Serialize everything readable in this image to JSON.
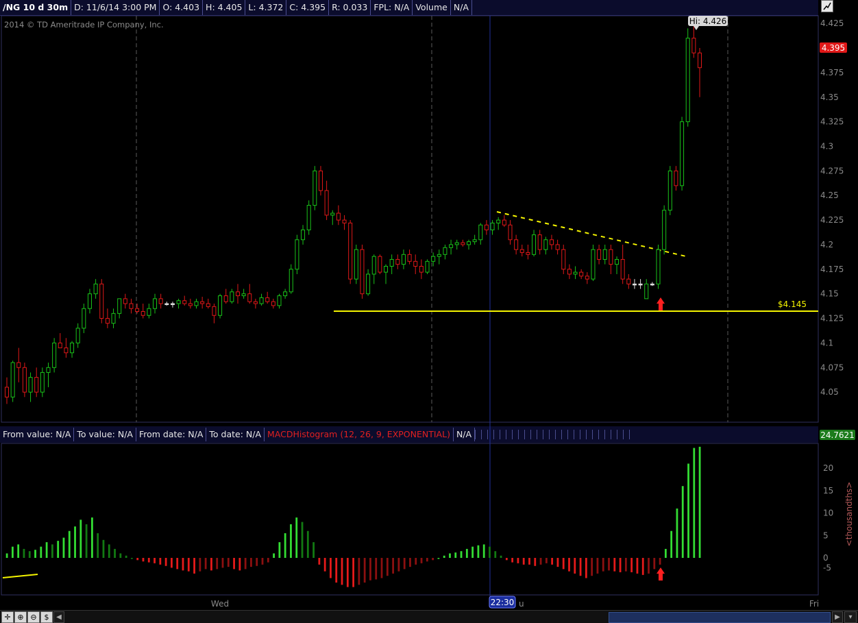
{
  "header": {
    "symbol": "/NG 10 d 30m",
    "date": "D: 11/6/14 3:00 PM",
    "open": "O: 4.403",
    "high": "H: 4.405",
    "low": "L: 4.372",
    "close": "C: 4.395",
    "range": "R: 0.033",
    "fpl": "FPL: N/A",
    "volume_label": "Volume",
    "volume_value": "N/A"
  },
  "copyright": "2014 © TD Ameritrade IP Company, Inc.",
  "hi_label": "Hi: 4.426",
  "last_price_label": "4.395",
  "level_label": "$4.145",
  "lower_header": {
    "from_value": "From value: N/A",
    "to_value": "To value: N/A",
    "from_date": "From date: N/A",
    "to_date": "To date: N/A",
    "study": "MACDHistogram (12, 26, 9, EXPONENTIAL)",
    "study_value": "N/A",
    "last_value": "24.7621"
  },
  "time_axis": {
    "wed": "Wed",
    "cursor": "22:30",
    "thu_fragment": "u",
    "fri": "Fri"
  },
  "colors": {
    "up": "#19c319",
    "down": "#e01818",
    "hist_strong_up": "#33dd33",
    "hist_weak_up": "#127a12",
    "hist_strong_down": "#e51a1a",
    "hist_weak_down": "#8c1010",
    "support_line": "#f5f500",
    "trendline": "#f5f500",
    "arrow": "#ff2020",
    "price_badge": "#e01818",
    "macd_badge": "#1c7c1c"
  },
  "chart_data": [
    {
      "type": "candlestick",
      "title": "/NG 10 d 30m",
      "ylim": [
        4.025,
        4.43
      ],
      "yticks": [
        "4.425",
        "4.4",
        "4.375",
        "4.35",
        "4.325",
        "4.3",
        "4.275",
        "4.25",
        "4.225",
        "4.2",
        "4.175",
        "4.15",
        "4.125",
        "4.1",
        "4.075",
        "4.05"
      ],
      "annotations": {
        "high": 4.426,
        "last": 4.395,
        "support_level": 4.145,
        "support_label": "$4.145"
      },
      "candles": [
        [
          4.055,
          4.065,
          4.038,
          4.045
        ],
        [
          4.045,
          4.082,
          4.04,
          4.08
        ],
        [
          4.08,
          4.095,
          4.06,
          4.075
        ],
        [
          4.075,
          4.08,
          4.045,
          4.05
        ],
        [
          4.05,
          4.07,
          4.04,
          4.065
        ],
        [
          4.065,
          4.075,
          4.045,
          4.05
        ],
        [
          4.05,
          4.075,
          4.045,
          4.07
        ],
        [
          4.07,
          4.08,
          4.055,
          4.075
        ],
        [
          4.075,
          4.105,
          4.07,
          4.1
        ],
        [
          4.1,
          4.11,
          4.095,
          4.095
        ],
        [
          4.095,
          4.105,
          4.085,
          4.09
        ],
        [
          4.09,
          4.102,
          4.085,
          4.1
        ],
        [
          4.1,
          4.12,
          4.095,
          4.115
        ],
        [
          4.115,
          4.14,
          4.11,
          4.135
        ],
        [
          4.135,
          4.155,
          4.13,
          4.15
        ],
        [
          4.15,
          4.165,
          4.145,
          4.16
        ],
        [
          4.16,
          4.165,
          4.12,
          4.125
        ],
        [
          4.125,
          4.135,
          4.115,
          4.12
        ],
        [
          4.12,
          4.135,
          4.115,
          4.13
        ],
        [
          4.13,
          4.145,
          4.125,
          4.145
        ],
        [
          4.145,
          4.15,
          4.135,
          4.14
        ],
        [
          4.14,
          4.145,
          4.13,
          4.135
        ],
        [
          4.135,
          4.14,
          4.13,
          4.132
        ],
        [
          4.132,
          4.14,
          4.125,
          4.128
        ],
        [
          4.128,
          4.14,
          4.125,
          4.135
        ],
        [
          4.135,
          4.15,
          4.13,
          4.145
        ],
        [
          4.145,
          4.15,
          4.135,
          4.14
        ],
        [
          4.14,
          4.142,
          4.138,
          4.14
        ],
        [
          4.14,
          4.142,
          4.136,
          4.14
        ],
        [
          4.14,
          4.145,
          4.135,
          4.143
        ],
        [
          4.143,
          4.148,
          4.138,
          4.14
        ],
        [
          4.14,
          4.145,
          4.135,
          4.138
        ],
        [
          4.138,
          4.145,
          4.135,
          4.142
        ],
        [
          4.142,
          4.147,
          4.135,
          4.14
        ],
        [
          4.14,
          4.145,
          4.135,
          4.137
        ],
        [
          4.137,
          4.14,
          4.12,
          4.128
        ],
        [
          4.128,
          4.15,
          4.125,
          4.148
        ],
        [
          4.148,
          4.155,
          4.14,
          4.142
        ],
        [
          4.142,
          4.155,
          4.14,
          4.152
        ],
        [
          4.152,
          4.16,
          4.14,
          4.148
        ],
        [
          4.148,
          4.155,
          4.145,
          4.15
        ],
        [
          4.15,
          4.16,
          4.14,
          4.142
        ],
        [
          4.142,
          4.145,
          4.135,
          4.14
        ],
        [
          4.14,
          4.15,
          4.138,
          4.146
        ],
        [
          4.146,
          4.152,
          4.14,
          4.142
        ],
        [
          4.142,
          4.145,
          4.135,
          4.138
        ],
        [
          4.138,
          4.15,
          4.135,
          4.148
        ],
        [
          4.148,
          4.155,
          4.145,
          4.152
        ],
        [
          4.152,
          4.18,
          4.15,
          4.175
        ],
        [
          4.175,
          4.21,
          4.17,
          4.205
        ],
        [
          4.205,
          4.22,
          4.2,
          4.215
        ],
        [
          4.215,
          4.245,
          4.21,
          4.24
        ],
        [
          4.24,
          4.28,
          4.235,
          4.275
        ],
        [
          4.275,
          4.28,
          4.25,
          4.255
        ],
        [
          4.255,
          4.265,
          4.225,
          4.23
        ],
        [
          4.23,
          4.235,
          4.22,
          4.232
        ],
        [
          4.232,
          4.24,
          4.22,
          4.225
        ],
        [
          4.225,
          4.23,
          4.215,
          4.222
        ],
        [
          4.222,
          4.225,
          4.16,
          4.165
        ],
        [
          4.165,
          4.2,
          4.16,
          4.195
        ],
        [
          4.195,
          4.2,
          4.145,
          4.15
        ],
        [
          4.15,
          4.175,
          4.148,
          4.17
        ],
        [
          4.17,
          4.19,
          4.16,
          4.188
        ],
        [
          4.188,
          4.19,
          4.17,
          4.172
        ],
        [
          4.172,
          4.18,
          4.16,
          4.178
        ],
        [
          4.178,
          4.19,
          4.17,
          4.185
        ],
        [
          4.185,
          4.19,
          4.175,
          4.18
        ],
        [
          4.18,
          4.195,
          4.175,
          4.19
        ],
        [
          4.19,
          4.195,
          4.18,
          4.183
        ],
        [
          4.183,
          4.19,
          4.17,
          4.178
        ],
        [
          4.178,
          4.185,
          4.165,
          4.172
        ],
        [
          4.172,
          4.185,
          4.17,
          4.183
        ],
        [
          4.183,
          4.192,
          4.178,
          4.188
        ],
        [
          4.188,
          4.195,
          4.18,
          4.19
        ],
        [
          4.19,
          4.2,
          4.185,
          4.197
        ],
        [
          4.197,
          4.205,
          4.19,
          4.2
        ],
        [
          4.2,
          4.205,
          4.195,
          4.202
        ],
        [
          4.202,
          4.205,
          4.198,
          4.2
        ],
        [
          4.2,
          4.205,
          4.195,
          4.203
        ],
        [
          4.203,
          4.21,
          4.2,
          4.205
        ],
        [
          4.205,
          4.222,
          4.2,
          4.22
        ],
        [
          4.22,
          4.225,
          4.21,
          4.215
        ],
        [
          4.215,
          4.225,
          4.21,
          4.222
        ],
        [
          4.222,
          4.228,
          4.215,
          4.225
        ],
        [
          4.225,
          4.23,
          4.218,
          4.22
        ],
        [
          4.22,
          4.225,
          4.2,
          4.205
        ],
        [
          4.205,
          4.21,
          4.19,
          4.195
        ],
        [
          4.195,
          4.2,
          4.188,
          4.192
        ],
        [
          4.192,
          4.2,
          4.185,
          4.19
        ],
        [
          4.19,
          4.215,
          4.188,
          4.21
        ],
        [
          4.21,
          4.215,
          4.19,
          4.195
        ],
        [
          4.195,
          4.208,
          4.19,
          4.205
        ],
        [
          4.205,
          4.21,
          4.195,
          4.2
        ],
        [
          4.2,
          4.205,
          4.19,
          4.195
        ],
        [
          4.195,
          4.2,
          4.17,
          4.175
        ],
        [
          4.175,
          4.18,
          4.165,
          4.17
        ],
        [
          4.17,
          4.178,
          4.165,
          4.172
        ],
        [
          4.172,
          4.175,
          4.165,
          4.168
        ],
        [
          4.168,
          4.172,
          4.16,
          4.165
        ],
        [
          4.165,
          4.2,
          4.163,
          4.195
        ],
        [
          4.195,
          4.2,
          4.18,
          4.185
        ],
        [
          4.185,
          4.2,
          4.18,
          4.195
        ],
        [
          4.195,
          4.2,
          4.17,
          4.18
        ],
        [
          4.18,
          4.188,
          4.17,
          4.185
        ],
        [
          4.185,
          4.2,
          4.16,
          4.165
        ],
        [
          4.165,
          4.17,
          4.155,
          4.16
        ],
        [
          4.16,
          4.165,
          4.155,
          4.16
        ],
        [
          4.16,
          4.165,
          4.155,
          4.16
        ],
        [
          4.145,
          4.165,
          4.145,
          4.16
        ],
        [
          4.16,
          4.162,
          4.158,
          4.16
        ],
        [
          4.16,
          4.2,
          4.155,
          4.195
        ],
        [
          4.195,
          4.24,
          4.19,
          4.235
        ],
        [
          4.235,
          4.28,
          4.23,
          4.275
        ],
        [
          4.275,
          4.28,
          4.255,
          4.26
        ],
        [
          4.26,
          4.33,
          4.255,
          4.325
        ],
        [
          4.325,
          4.42,
          4.32,
          4.41
        ],
        [
          4.41,
          4.426,
          4.39,
          4.395
        ],
        [
          4.395,
          4.4,
          4.35,
          4.38
        ]
      ]
    },
    {
      "type": "bar",
      "title": "MACDHistogram (12, 26, 9, EXPONENTIAL)",
      "ylabel": "<thousandths>",
      "ylim": [
        -10,
        25
      ],
      "yticks": [
        "20",
        "15",
        "10",
        "5",
        "0",
        "-5"
      ],
      "values": [
        1.0,
        2.5,
        3.0,
        2.0,
        1.5,
        1.8,
        2.5,
        3.5,
        3.0,
        3.8,
        4.5,
        6.0,
        7.0,
        8.5,
        7.5,
        9.0,
        5.5,
        4.0,
        3.0,
        2.0,
        1.0,
        0.5,
        0.0,
        -0.5,
        -0.8,
        -1.0,
        -1.2,
        -1.5,
        -1.8,
        -2.2,
        -2.5,
        -2.8,
        -3.0,
        -3.5,
        -3.0,
        -2.5,
        -2.8,
        -2.5,
        -2.2,
        -2.0,
        -2.5,
        -2.8,
        -2.5,
        -2.0,
        -1.8,
        -1.5,
        -1.0,
        1.0,
        3.5,
        5.5,
        7.5,
        9.0,
        8.0,
        6.0,
        3.5,
        -1.5,
        -3.0,
        -4.5,
        -5.5,
        -6.0,
        -6.5,
        -6.5,
        -6.0,
        -5.5,
        -5.0,
        -4.8,
        -4.5,
        -4.0,
        -3.5,
        -3.0,
        -2.5,
        -2.0,
        -1.5,
        -1.2,
        -0.8,
        -0.5,
        0.0,
        0.5,
        1.0,
        1.2,
        1.5,
        2.0,
        2.5,
        2.8,
        3.0,
        2.5,
        1.5,
        0.5,
        -0.5,
        -1.0,
        -1.2,
        -1.5,
        -1.5,
        -1.8,
        -1.5,
        -1.2,
        -1.5,
        -2.0,
        -2.5,
        -3.0,
        -3.5,
        -4.0,
        -4.5,
        -4.0,
        -3.5,
        -3.0,
        -2.8,
        -3.0,
        -3.2,
        -3.0,
        -3.2,
        -3.5,
        -3.8,
        -3.5,
        -2.5,
        -1.5,
        2.0,
        6.0,
        11.0,
        16.0,
        21.0,
        24.5,
        24.76
      ]
    }
  ]
}
